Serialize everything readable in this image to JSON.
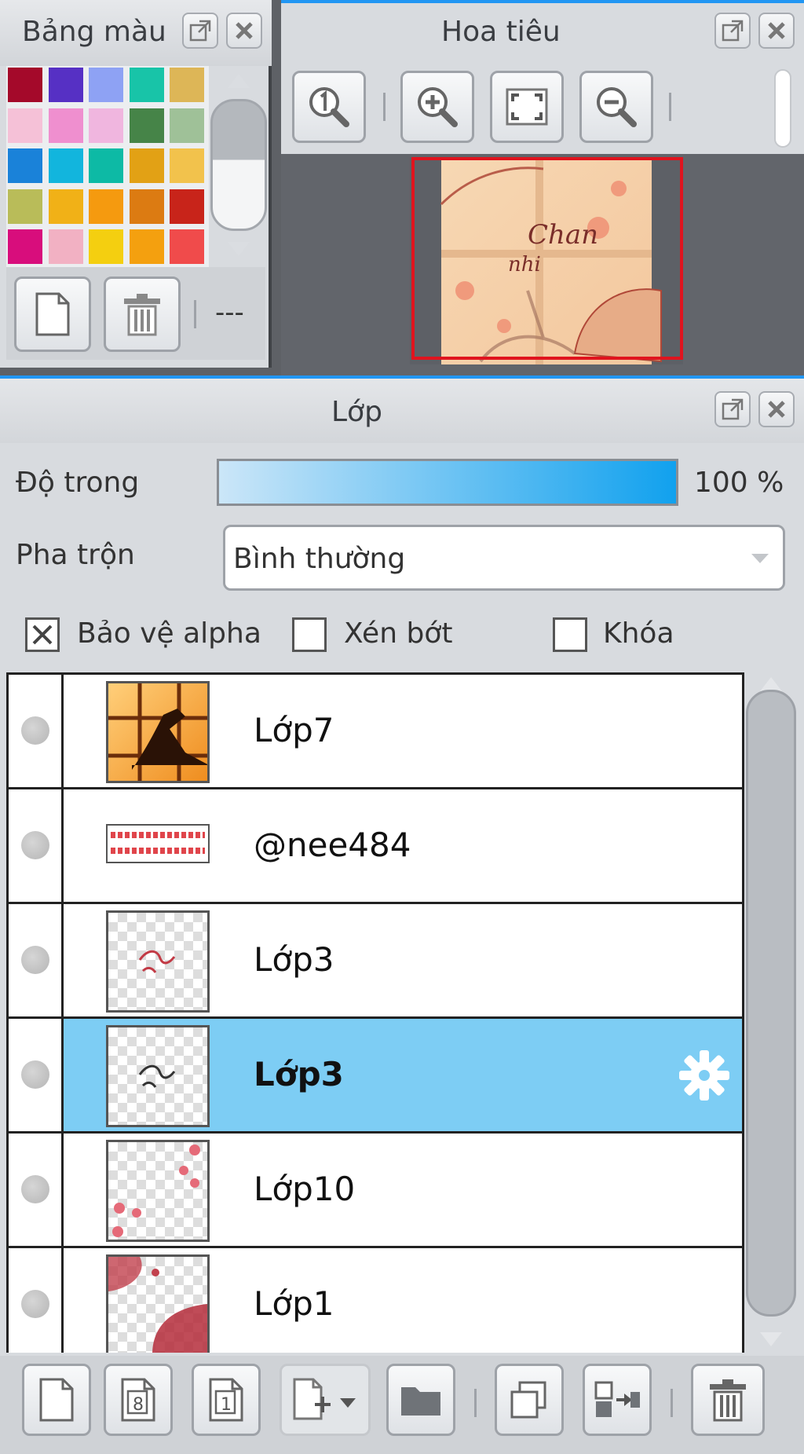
{
  "palette_panel": {
    "title": "Bảng màu",
    "swatches": [
      "#a4092a",
      "#5630c4",
      "#8ea2f4",
      "#18c4a8",
      "#ddb657",
      "#f5c1d7",
      "#ef8fcf",
      "#f0b6df",
      "#468448",
      "#9fc198",
      "#1a82d9",
      "#12b5dd",
      "#0dbaa5",
      "#e2a115",
      "#f2c24c",
      "#b9bc59",
      "#f1b117",
      "#f59a0f",
      "#dc7b12",
      "#c8241a",
      "#d80d7c",
      "#f2b1c3",
      "#f4cf10",
      "#f4a00f",
      "#f04b4b"
    ],
    "dash_label": "---"
  },
  "navigator_panel": {
    "title": "Hoa tiêu"
  },
  "layer_panel": {
    "title": "Lớp",
    "opacity_label": "Độ trong",
    "opacity_value": "100 %",
    "opacity_fraction": 1.0,
    "blend_label": "Pha trộn",
    "blend_value": "Bình thường",
    "protect_alpha_label": "Bảo vệ alpha",
    "protect_alpha_checked": true,
    "clip_label": "Xén bớt",
    "clip_checked": false,
    "lock_label": "Khóa",
    "lock_checked": false,
    "layers": [
      {
        "name": "Lớp7",
        "selected": false
      },
      {
        "name": "@nee484",
        "selected": false
      },
      {
        "name": "Lớp3",
        "selected": false
      },
      {
        "name": "Lớp3",
        "selected": true
      },
      {
        "name": "Lớp10",
        "selected": false
      },
      {
        "name": "Lớp1",
        "selected": false
      }
    ],
    "toolbar_icons": [
      "new-layer-icon",
      "new-8bit-layer-icon",
      "new-1bit-layer-icon",
      "add-layer-dropdown-icon",
      "folder-icon",
      "duplicate-icon",
      "merge-down-icon",
      "delete-layer-icon"
    ]
  },
  "colors": {
    "accent": "#2196f3",
    "selected_row": "#7dcdf4",
    "nav_frame": "#e0141e"
  }
}
